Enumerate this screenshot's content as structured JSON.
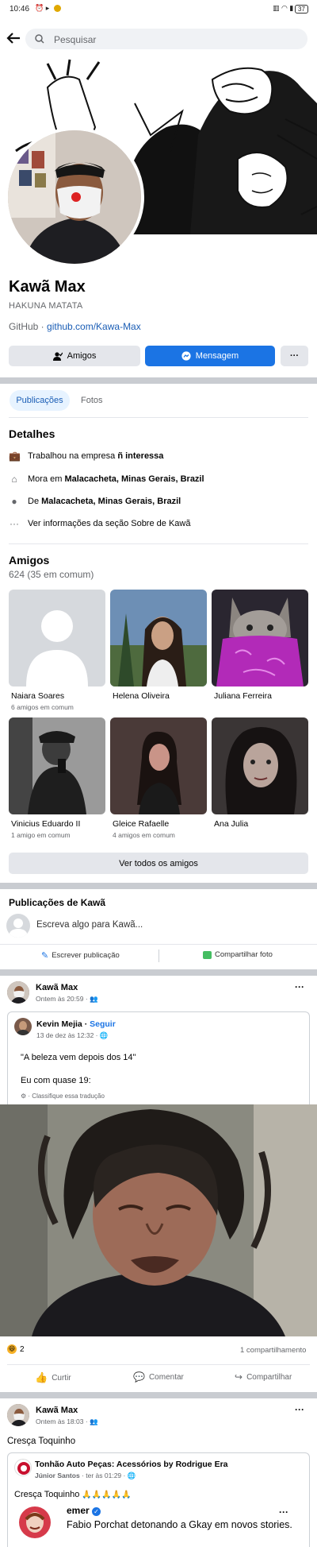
{
  "status": {
    "time": "10:46",
    "battery": "37"
  },
  "search": {
    "placeholder": "Pesquisar"
  },
  "profile": {
    "name": "Kawã Max",
    "bio": "HAKUNA MATATA",
    "link_prefix": "GitHub · ",
    "link_url": "github.com/Kawa-Max"
  },
  "actions": {
    "friends": "Amigos",
    "message": "Mensagem",
    "more": "···"
  },
  "tabs": {
    "posts": "Publicações",
    "photos": "Fotos"
  },
  "details": {
    "title": "Detalhes",
    "work_prefix": "Trabalhou na empresa ",
    "work_bold": "ñ interessa",
    "lives_prefix": "Mora em ",
    "lives_bold": "Malacacheta, Minas Gerais, Brazil",
    "from_prefix": "De ",
    "from_bold": "Malacacheta, Minas Gerais, Brazil",
    "about": "Ver informações da seção Sobre de Kawã"
  },
  "friends": {
    "title": "Amigos",
    "count": "624 (35 em comum)",
    "list": [
      {
        "name": "Naiara Soares",
        "mutual": "6 amigos em comum"
      },
      {
        "name": "Helena Oliveira",
        "mutual": ""
      },
      {
        "name": "Juliana Ferreira",
        "mutual": ""
      },
      {
        "name": "Vinicius Eduardo II",
        "mutual": "1 amigo em comum"
      },
      {
        "name": "Gleice Rafaelle",
        "mutual": "4 amigos em comum"
      },
      {
        "name": "Ana Julia",
        "mutual": ""
      }
    ],
    "see_all": "Ver todos os amigos"
  },
  "composer": {
    "title": "Publicações de Kawã",
    "placeholder": "Escreva algo para Kawã...",
    "write": "Escrever publicação",
    "share_photo": "Compartilhar foto"
  },
  "post1": {
    "author": "Kawã Max",
    "time": "Ontem às 20:59 ·",
    "shared_author": "Kevin Mejia",
    "follow": "Seguir",
    "shared_time": "13 de dez às 12:32 ·",
    "text1": "\"A beleza vem depois dos 14\"",
    "text2": "Eu com quase 19:",
    "translate": "· Classifique essa tradução",
    "reactions": "2",
    "shares": "1 compartilhamento",
    "like": "Curtir",
    "comment": "Comentar",
    "share": "Compartilhar"
  },
  "post2": {
    "author": "Kawã Max",
    "time": "Ontem às 18:03 ·",
    "text": "Cresça Toquinho",
    "shared_page": "Tonhão Auto Peças: Acessórios by Rodrigue Era",
    "shared_author": "Júnior Santos",
    "shared_time": "· ter às 01:29 ·",
    "shared_text": "Cresça Toquinho",
    "shared_emojis": "🙏🙏🙏🙏🙏",
    "inner_author": "emer",
    "inner_text": "Fabio Porchat detonando a Gkay em novos stories."
  }
}
